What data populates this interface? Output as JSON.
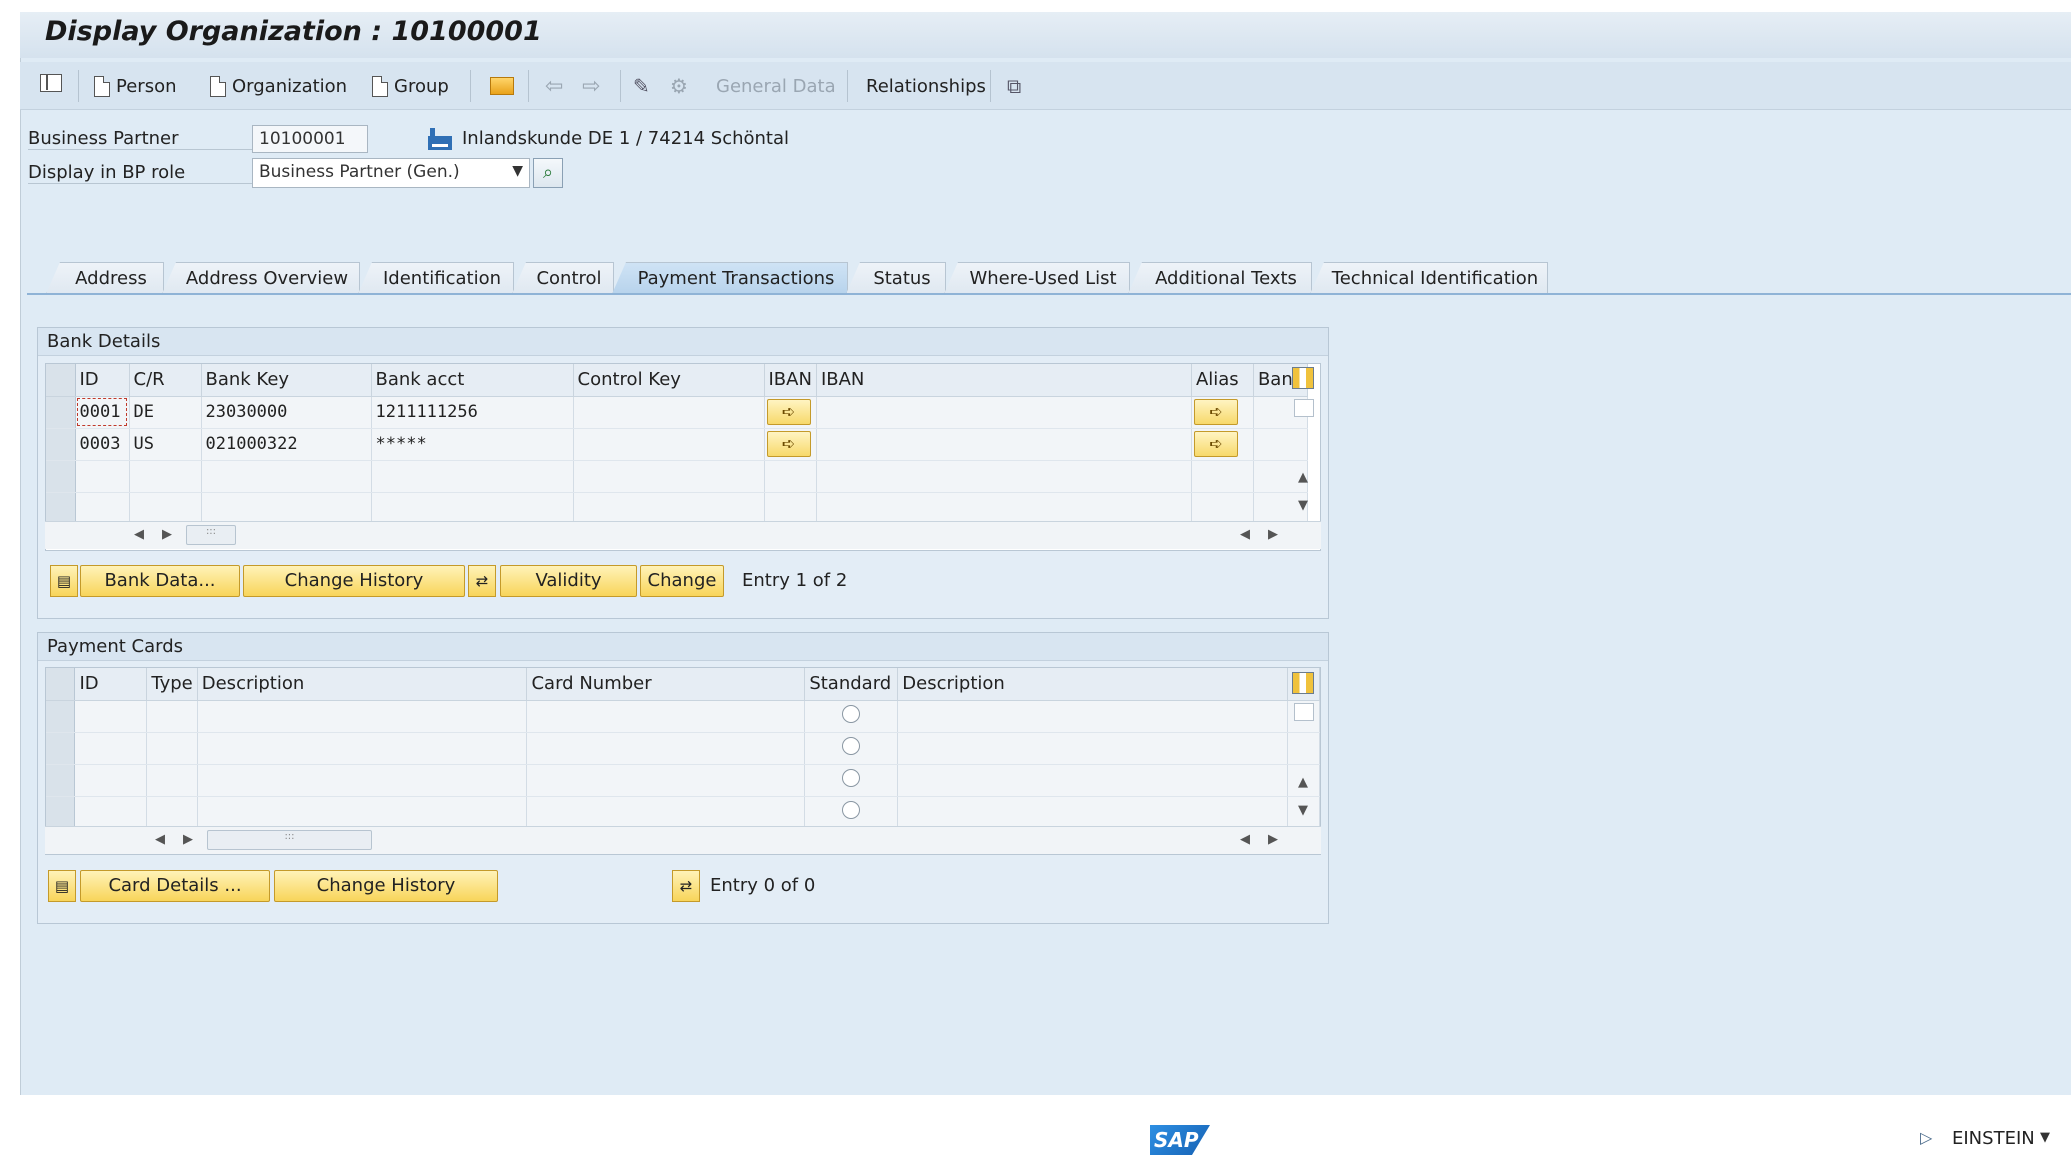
{
  "window": {
    "title": "Display Organization : 10100001"
  },
  "toolbar": {
    "items": [
      {
        "label": "Person",
        "icon": "new-document-icon"
      },
      {
        "label": "Organization",
        "icon": "new-document-icon"
      },
      {
        "label": "Group",
        "icon": "new-document-icon"
      },
      {
        "label": "General Data",
        "icon": "disabled"
      },
      {
        "label": "Relationships",
        "icon": ""
      }
    ]
  },
  "header": {
    "bp_label": "Business Partner",
    "bp_value": "10100001",
    "bp_description": "Inlandskunde DE 1 / 74214 Schöntal",
    "role_label": "Display in BP role",
    "role_value": "Business Partner (Gen.)"
  },
  "tabs": [
    {
      "label": "Address"
    },
    {
      "label": "Address Overview"
    },
    {
      "label": "Identification"
    },
    {
      "label": "Control"
    },
    {
      "label": "Payment Transactions",
      "active": true
    },
    {
      "label": "Status"
    },
    {
      "label": "Where-Used List"
    },
    {
      "label": "Additional Texts"
    },
    {
      "label": "Technical Identification"
    }
  ],
  "bank_details": {
    "title": "Bank Details",
    "columns": [
      "ID",
      "C/R",
      "Bank Key",
      "Bank acct",
      "Control Key",
      "IBAN",
      "IBAN",
      "Alias",
      "Bank"
    ],
    "rows": [
      {
        "id": "0001",
        "cr": "DE",
        "bank_key": "23030000",
        "bank_acct": "1211111256",
        "control_key": ""
      },
      {
        "id": "0003",
        "cr": "US",
        "bank_key": "021000322",
        "bank_acct": "*****",
        "control_key": ""
      }
    ],
    "buttons": {
      "bank_data": "Bank Data...",
      "change_history": "Change History",
      "validity": "Validity",
      "change": "Change"
    },
    "entry_text": "Entry 1 of 2"
  },
  "payment_cards": {
    "title": "Payment Cards",
    "columns": [
      "ID",
      "Type",
      "Description",
      "Card Number",
      "Standard",
      "Description"
    ],
    "buttons": {
      "card_details": "Card Details ...",
      "change_history": "Change History"
    },
    "entry_text": "Entry 0 of 0"
  },
  "status_bar": {
    "user": "EINSTEIN",
    "logo": "SAP"
  },
  "colors": {
    "tab_active": "#b7d3ec",
    "button_yellow": "#f8d55a",
    "background": "#dfebf5"
  }
}
